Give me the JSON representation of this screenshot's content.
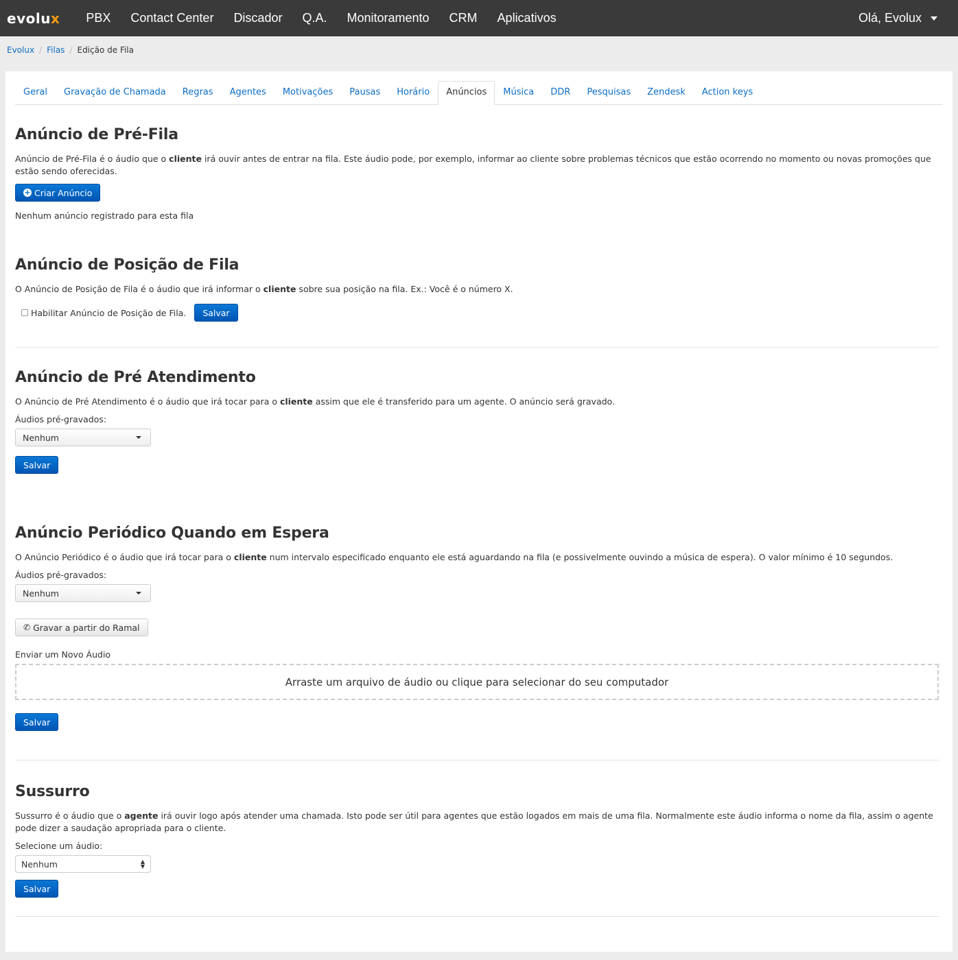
{
  "navbar": {
    "logo": "evolu",
    "logo_x": "x",
    "items": [
      "PBX",
      "Contact Center",
      "Discador",
      "Q.A.",
      "Monitoramento",
      "CRM",
      "Aplicativos"
    ],
    "user": "Olá, Evolux"
  },
  "breadcrumb": {
    "items": [
      "Evolux",
      "Filas"
    ],
    "current": "Edição de Fila"
  },
  "tabs": {
    "items": [
      "Geral",
      "Gravação de Chamada",
      "Regras",
      "Agentes",
      "Motivações",
      "Pausas",
      "Horário",
      "Anúncios",
      "Música",
      "DDR",
      "Pesquisas",
      "Zendesk",
      "Action keys"
    ],
    "active": "Anúncios"
  },
  "prefila": {
    "title": "Anúncio de Pré-Fila",
    "desc_1": "Anúncio de Pré-Fila é o áudio que o ",
    "desc_bold": "cliente",
    "desc_2": " irá ouvir antes de entrar na fila. Este áudio pode, por exemplo, informar ao cliente sobre problemas técnicos que estão ocorrendo no momento ou novas promoções que estão sendo oferecidas.",
    "button": "Criar Anúncio",
    "empty": "Nenhum anúncio registrado para esta fila"
  },
  "posicao": {
    "title": "Anúncio de Posição de Fila",
    "desc_1": "O Anúncio de Posição de Fila é o áudio que irá informar o ",
    "desc_bold": "cliente",
    "desc_2": " sobre sua posição na fila. Ex.: Você é o número X.",
    "checkbox_label": "Habilitar Anúncio de Posição de Fila.",
    "button": "Salvar"
  },
  "preatendimento": {
    "title": "Anúncio de Pré Atendimento",
    "desc_1": "O Anúncio de Pré Atendimento é o áudio que irá tocar para o ",
    "desc_bold": "cliente",
    "desc_2": " assim que ele é transferido para um agente. O anúncio será gravado.",
    "label": "Áudios pré-gravados:",
    "select_value": "Nenhum",
    "button": "Salvar"
  },
  "periodico": {
    "title": "Anúncio Periódico Quando em Espera",
    "desc_1": "O Anúncio Periódico é o áudio que irá tocar para o ",
    "desc_bold": "cliente",
    "desc_2": " num intervalo especificado enquanto ele está aguardando na fila (e possivelmente ouvindo a música de espera). O valor mínimo é 10 segundos.",
    "label": "Áudios pré-gravados:",
    "select_value": "Nenhum",
    "record_button": "Gravar a partir do Ramal",
    "upload_label": "Enviar um Novo Áudio",
    "dropzone": "Arraste um arquivo de áudio ou clique para selecionar do seu computador",
    "button": "Salvar"
  },
  "sussurro": {
    "title": "Sussurro",
    "desc_1": "Sussurro é o áudio que o ",
    "desc_bold": "agente",
    "desc_2": " irá ouvir logo após atender uma chamada. Isto pode ser útil para agentes que estão logados em mais de uma fila. Normalmente este áudio informa o nome da fila, assim o agente pode dizer a saudação apropriada para o cliente.",
    "label": "Selecione um áudio:",
    "select_value": "Nenhum",
    "button": "Salvar"
  }
}
